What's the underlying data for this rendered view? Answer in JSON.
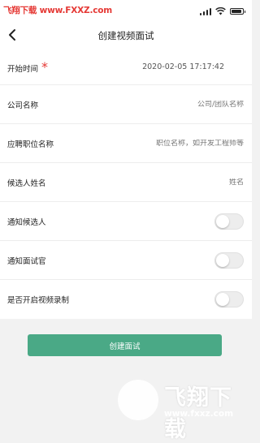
{
  "status_bar": {
    "watermark": "飞翔下载 www.FXXZ.com"
  },
  "nav": {
    "title": "创建视频面试"
  },
  "form": {
    "start_time": {
      "label": "开始时间",
      "required_mark": "*",
      "value": "2020-02-05 17:17:42"
    },
    "company": {
      "label": "公司名称",
      "placeholder": "公司/团队名称"
    },
    "position": {
      "label": "应聘职位名称",
      "placeholder": "职位名称，如开发工程师等"
    },
    "candidate": {
      "label": "候选人姓名",
      "placeholder": "姓名"
    },
    "notify_candidate": {
      "label": "通知候选人",
      "on": false
    },
    "notify_interviewer": {
      "label": "通知面试官",
      "on": false
    },
    "record_video": {
      "label": "是否开启视频录制",
      "on": false
    }
  },
  "submit": {
    "label": "创建面试"
  },
  "watermark": {
    "logo_text": "飞翔下载",
    "site": "www.fxxz.com"
  }
}
